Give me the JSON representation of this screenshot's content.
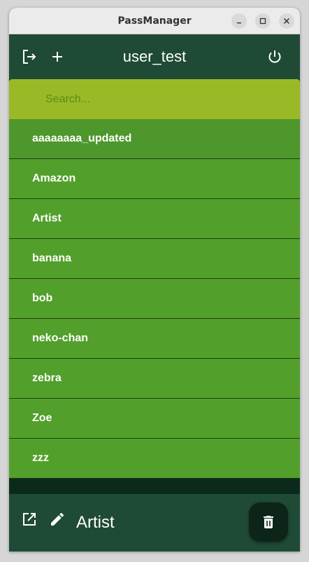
{
  "window": {
    "title": "PassManager"
  },
  "appbar": {
    "username": "user_test"
  },
  "search": {
    "placeholder": "Search..."
  },
  "entries": [
    "aaaaaaaa_updated",
    "Amazon",
    "Artist",
    "banana",
    "bob",
    "neko-chan",
    "zebra",
    "Zoe",
    "zzz"
  ],
  "selected": {
    "name": "Artist"
  },
  "colors": {
    "appbar": "#1e4a36",
    "search_bg": "#9ab926",
    "row_bg": "#52a02b",
    "background": "#0c2a1b",
    "fab": "#0d2418"
  },
  "icons": {
    "appbar_left": [
      "logout-icon",
      "add-icon"
    ],
    "appbar_right": "power-icon",
    "bottom_left": [
      "open-external-icon",
      "edit-icon"
    ],
    "fab": "delete-icon"
  }
}
